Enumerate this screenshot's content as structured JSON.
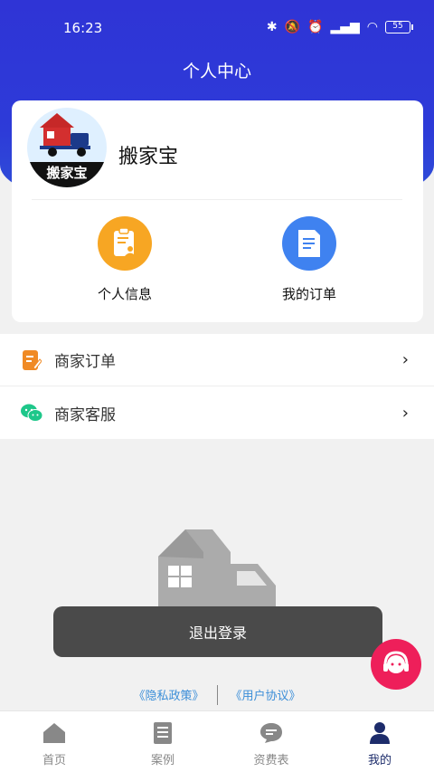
{
  "status": {
    "time": "16:23",
    "battery": "55"
  },
  "header": {
    "title": "个人中心"
  },
  "profile": {
    "avatar_text": "搬家宝",
    "username": "搬家宝",
    "shortcuts": [
      {
        "label": "个人信息",
        "icon": "person-info-icon",
        "color": "#f7a623"
      },
      {
        "label": "我的订单",
        "icon": "order-icon",
        "color": "#3f82f0"
      }
    ]
  },
  "menu": [
    {
      "label": "商家订单",
      "icon": "edit-note-icon"
    },
    {
      "label": "商家客服",
      "icon": "wechat-icon"
    }
  ],
  "toast": {
    "label": "退出登录"
  },
  "legal": {
    "privacy": "《隐私政策》",
    "agreement": "《用户协议》"
  },
  "tabs": [
    {
      "label": "首页",
      "icon": "home-icon",
      "active": false
    },
    {
      "label": "案例",
      "icon": "cases-icon",
      "active": false
    },
    {
      "label": "资费表",
      "icon": "price-icon",
      "active": false
    },
    {
      "label": "我的",
      "icon": "user-icon",
      "active": true
    }
  ],
  "colors": {
    "primary": "#2f34d6",
    "accent_pink": "#ee1f5a",
    "legal_link": "#3b8ed8"
  }
}
